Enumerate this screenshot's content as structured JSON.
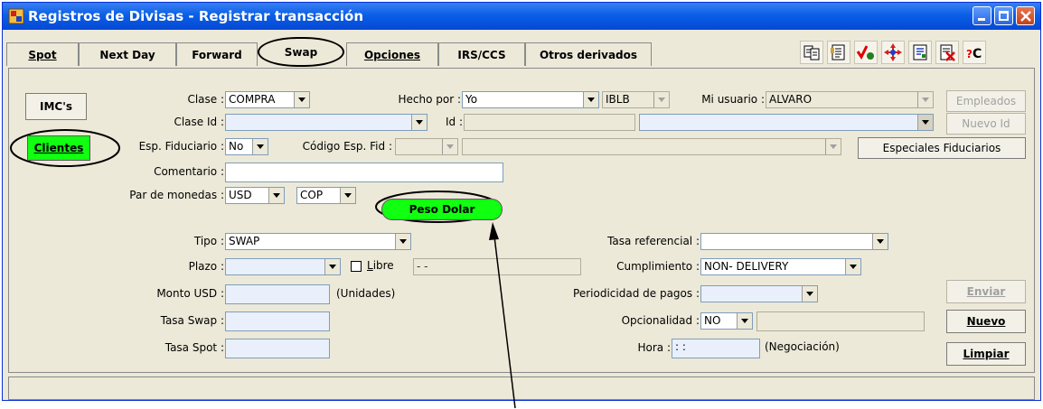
{
  "window": {
    "title": "Registros de Divisas - Registrar transacción"
  },
  "tabs": [
    "Spot",
    "Next Day",
    "Forward",
    "Swap",
    "Opciones",
    "IRS/CCS",
    "Otros derivados"
  ],
  "left_buttons": {
    "imcs": "IMC's",
    "clientes": "Clientes"
  },
  "form": {
    "clase_label": "Clase :",
    "clase_value": "COMPRA",
    "hecho_por_label": "Hecho por :",
    "hecho_por_value": "Yo",
    "hecho_por_code": "IBLB",
    "mi_usuario_label": "Mi usuario :",
    "mi_usuario_value": "ALVARO",
    "empleados_button": "Empleados",
    "clase_id_label": "Clase Id :",
    "id_label": "Id :",
    "nuevo_id_button": "Nuevo Id",
    "esp_fiduciario_label": "Esp. Fiduciario :",
    "esp_fiduciario_value": "No",
    "codigo_esp_fid_label": "Código Esp. Fid :",
    "especiales_fiduciarios_button": "Especiales Fiduciarios",
    "comentario_label": "Comentario :",
    "par_monedas_label": "Par de monedas :",
    "moneda1": "USD",
    "moneda2": "COP",
    "peso_dolar_button": "Peso Dolar",
    "tipo_label": "Tipo :",
    "tipo_value": "SWAP",
    "tasa_referencial_label": "Tasa referencial :",
    "plazo_label": "Plazo :",
    "libre_label": "Libre",
    "plazo_fecha": "  -  -",
    "cumplimiento_label": "Cumplimiento :",
    "cumplimiento_value": "NON- DELIVERY",
    "monto_usd_label": "Monto USD :",
    "unidades_label": "(Unidades)",
    "periodicidad_label": "Periodicidad de pagos :",
    "tasa_swap_label": "Tasa Swap :",
    "opcionalidad_label": "Opcionalidad :",
    "opcionalidad_value": "NO",
    "tasa_spot_label": "Tasa Spot :",
    "hora_label": "Hora :",
    "hora_value": " :  :",
    "negociacion_label": "(Negociación)"
  },
  "actions": {
    "enviar": "Enviar",
    "nuevo": "Nuevo",
    "limpiar": "Limpiar"
  },
  "colors": {
    "highlight_green": "#11ff11",
    "title_blue": "#0a5fe6"
  },
  "icons": [
    "copy-icon",
    "document-icon",
    "check-icon",
    "move-icon",
    "report-icon",
    "cancel-doc-icon",
    "currency-c-icon"
  ]
}
